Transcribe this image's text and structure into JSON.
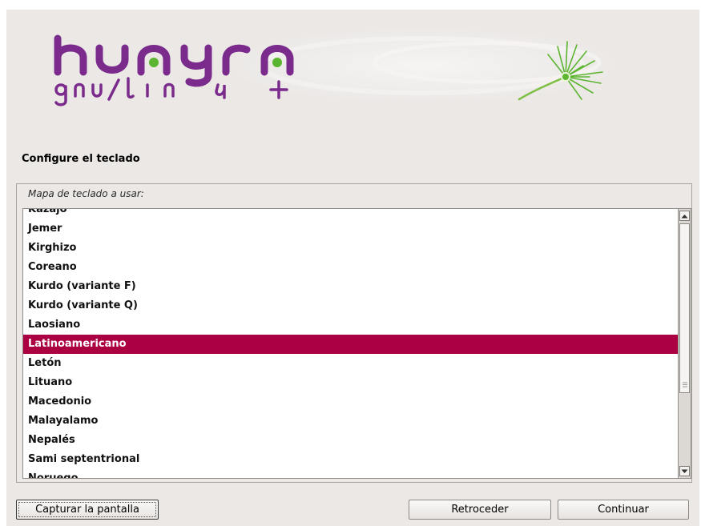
{
  "branding": {
    "logo_word": "huayra",
    "logo_sub": "gnu/linux"
  },
  "page": {
    "title": "Configure el teclado"
  },
  "keymap": {
    "label": "Mapa de teclado a usar:",
    "items": [
      "Kazajo",
      "Jemer",
      "Kirghizo",
      "Coreano",
      "Kurdo (variante F)",
      "Kurdo (variante Q)",
      "Laosiano",
      "Latinoamericano",
      "Letón",
      "Lituano",
      "Macedonio",
      "Malayalamo",
      "Nepalés",
      "Sami septentrional",
      "Noruego"
    ],
    "selected": "Latinoamericano"
  },
  "buttons": {
    "screenshot": "Capturar la pantalla",
    "back": "Retroceder",
    "continue": "Continuar"
  },
  "colors": {
    "selection": "#ab0042",
    "logo": "#7a2b8c",
    "accent": "#5cb531"
  }
}
